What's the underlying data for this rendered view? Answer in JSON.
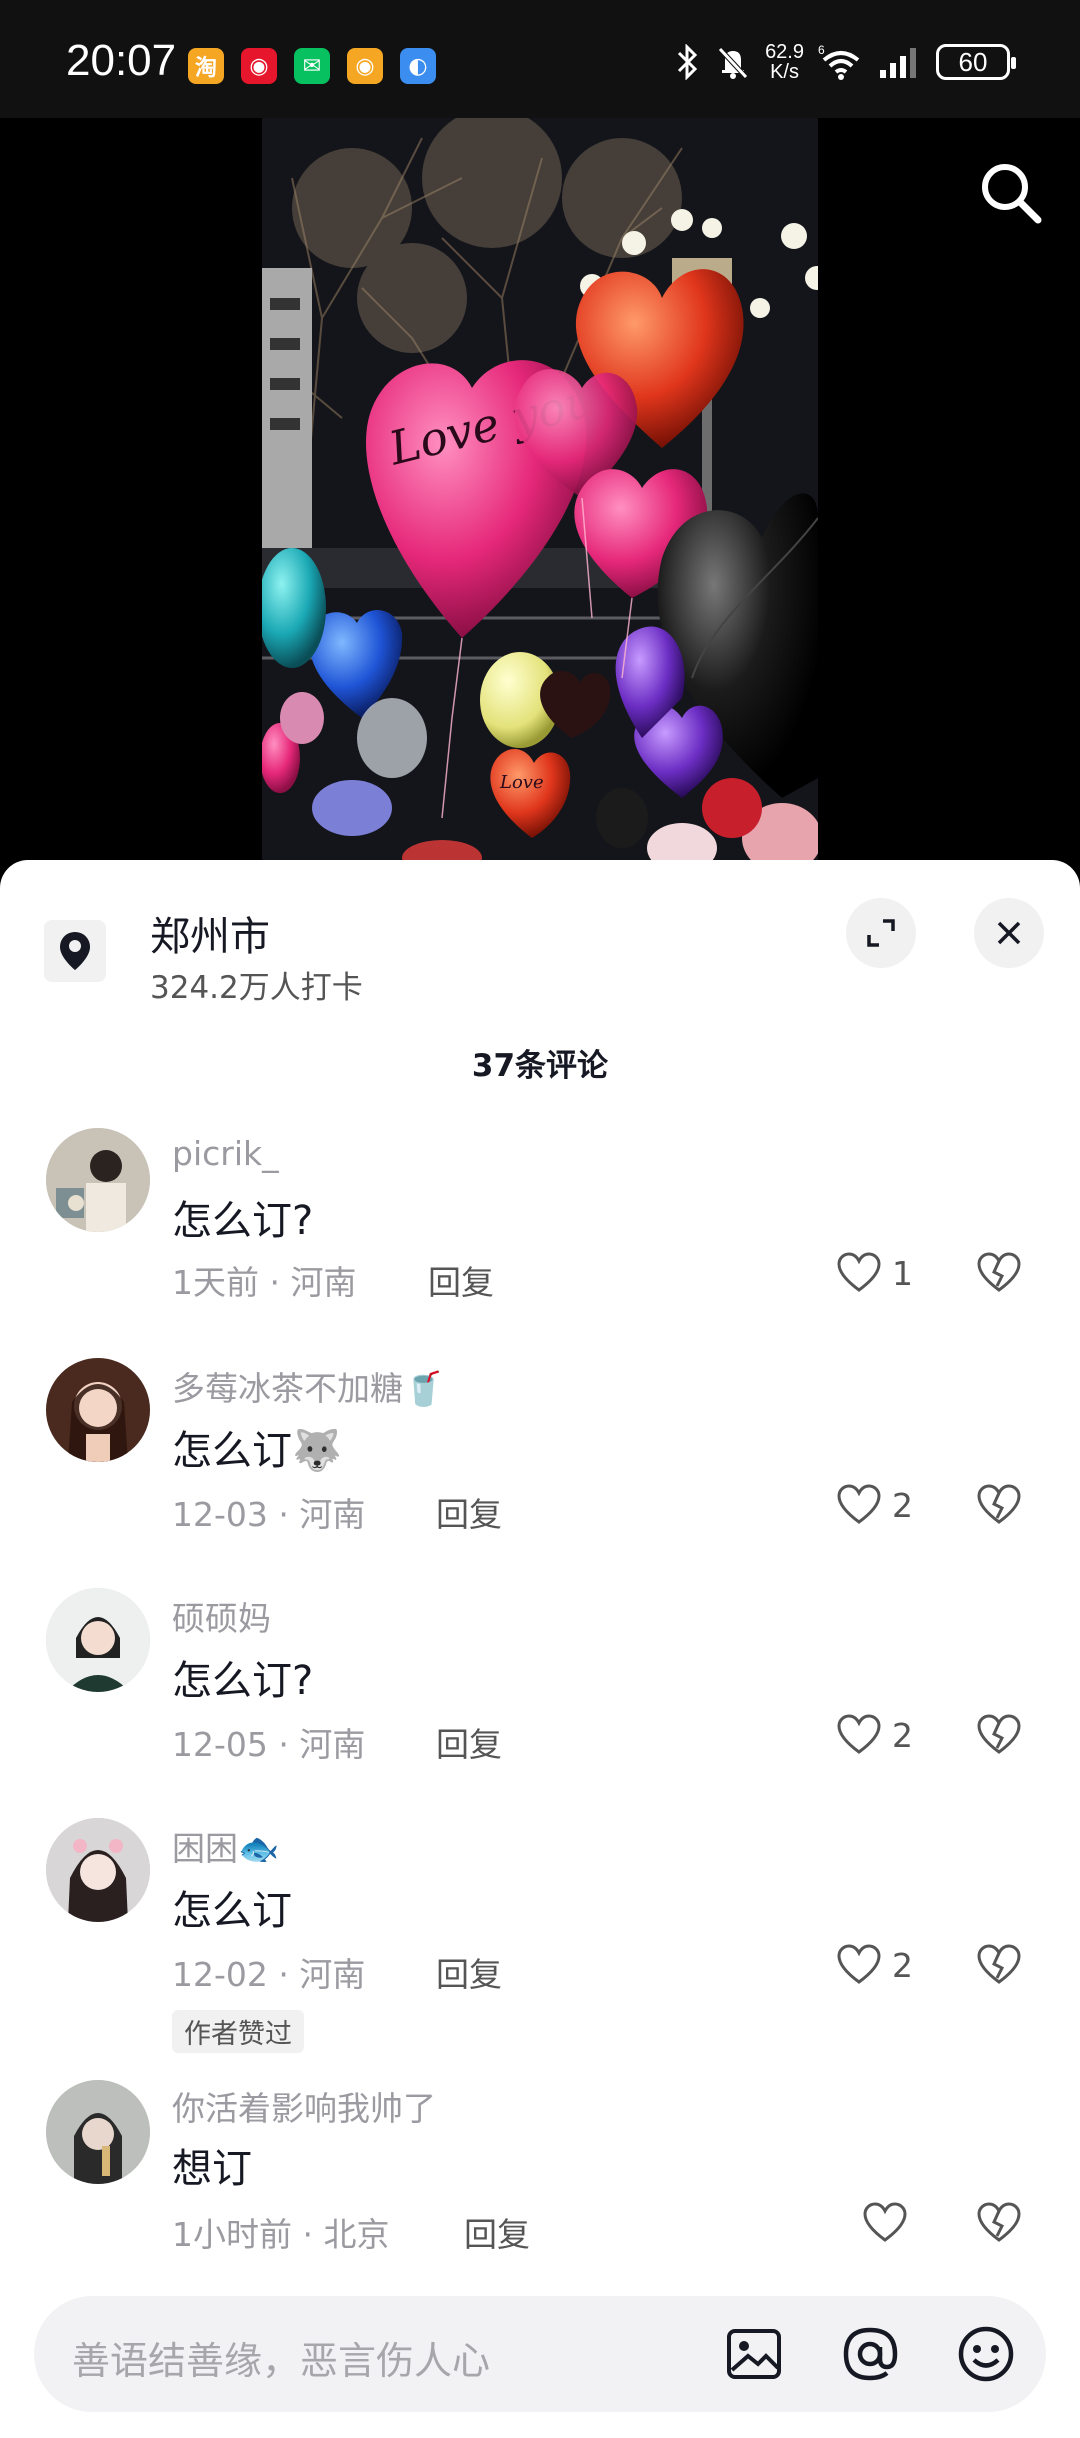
{
  "status_bar": {
    "time": "20:07",
    "net_speed_value": "62.9",
    "net_speed_unit": "K/s",
    "battery": "60",
    "app_icons": [
      "taobao-icon",
      "weibo-icon",
      "wechat-icon",
      "weibo-icon",
      "browser-icon"
    ]
  },
  "location": {
    "title": "郑州市",
    "subtitle": "324.2万人打卡"
  },
  "comments_header": "37条评论",
  "comments": [
    {
      "user": "picrik_",
      "text": "怎么订?",
      "time": "1天前",
      "region": "河南",
      "reply": "回复",
      "likes": "1"
    },
    {
      "user": "多莓冰茶不加糖🥤",
      "text": "怎么订🐺",
      "time": "12-03",
      "region": "河南",
      "reply": "回复",
      "likes": "2"
    },
    {
      "user": "硕硕妈",
      "text": "怎么订?",
      "time": "12-05",
      "region": "河南",
      "reply": "回复",
      "likes": "2"
    },
    {
      "user": "困困🐟",
      "text": "怎么订",
      "time": "12-02",
      "region": "河南",
      "reply": "回复",
      "likes": "2",
      "badge": "作者赞过"
    },
    {
      "user": "你活着影响我帅了",
      "text": "想订",
      "time": "1小时前",
      "region": "北京",
      "reply": "回复",
      "likes": ""
    }
  ],
  "input": {
    "placeholder": "善语结善缘，恶言伤人心"
  },
  "video": {
    "balloon_text": "Love you"
  }
}
